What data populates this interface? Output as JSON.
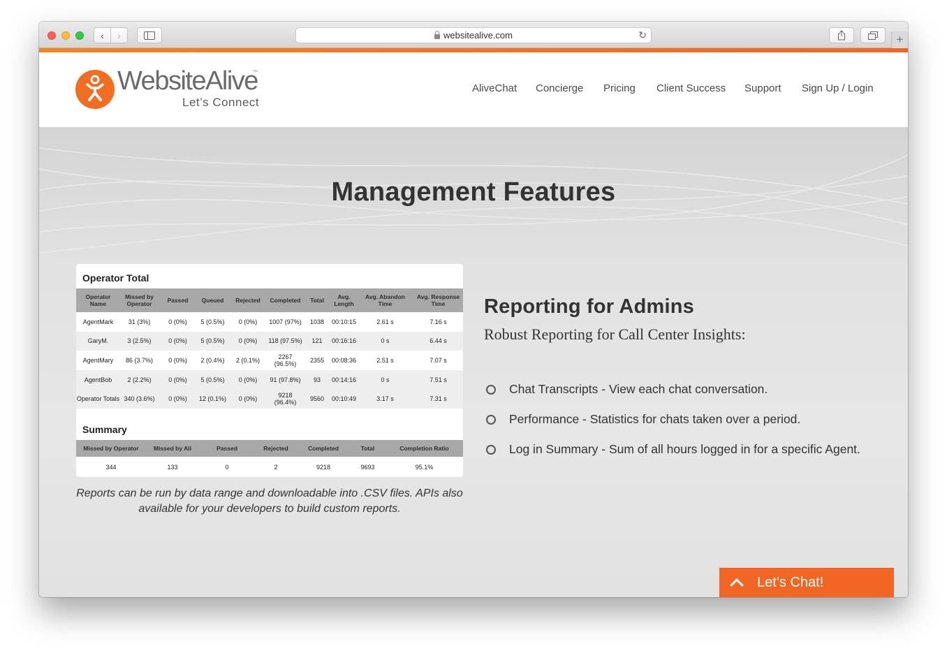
{
  "browser": {
    "url": "websitealive.com"
  },
  "site": {
    "logo_name": "WebsiteAlive",
    "logo_tm": "™",
    "logo_tagline": "Let’s Connect",
    "brand_color": "#f26522",
    "nav": [
      "AliveChat",
      "Concierge",
      "Pricing",
      "Client Success",
      "Support",
      "Sign Up / Login"
    ]
  },
  "hero": {
    "title": "Management Features"
  },
  "report": {
    "title": "Operator Total",
    "columns": [
      "Operator Name",
      "Missed by Operator",
      "Passed",
      "Queued",
      "Rejected",
      "Completed",
      "Total",
      "Avg. Length",
      "Avg. Abandon Time",
      "Avg. Response Time"
    ],
    "rows": [
      [
        "AgentMark",
        "31 (3%)",
        "0 (0%)",
        "5 (0.5%)",
        "0 (0%)",
        "1007 (97%)",
        "1038",
        "00:10:15",
        "2.61 s",
        "7.16 s"
      ],
      [
        "GaryM.",
        "3 (2.5%)",
        "0 (0%)",
        "5 (0.5%)",
        "0 (0%)",
        "118 (97.5%)",
        "121",
        "00:16:16",
        "0 s",
        "6.44 s"
      ],
      [
        "AgentMary",
        "86 (3.7%)",
        "0 (0%)",
        "2 (0.4%)",
        "2 (0.1%)",
        "2267 (96.5%)",
        "2355",
        "00:08:36",
        "2.51 s",
        "7.07 s"
      ],
      [
        "AgentBob",
        "2 (2.2%)",
        "0 (0%)",
        "5 (0.5%)",
        "0 (0%)",
        "91 (97.8%)",
        "93",
        "00:14:16",
        "0 s",
        "7.51 s"
      ],
      [
        "Operator Totals",
        "340 (3.6%)",
        "0 (0%)",
        "12 (0.1%)",
        "0 (0%)",
        "9218 (96.4%)",
        "9560",
        "00:10:49",
        "3.17 s",
        "7.31 s"
      ]
    ],
    "summary_title": "Summary",
    "summary_columns": [
      "Missed by Operator",
      "Missed by All",
      "Passed",
      "Rejected",
      "Completed",
      "Total",
      "Completion Ratio"
    ],
    "summary_values": [
      "344",
      "133",
      "0",
      "2",
      "9218",
      "9693",
      "95.1%"
    ],
    "caption": "Reports can be run by data range and downloadable into .CSV files. APIs also available for your developers to build custom reports."
  },
  "features": {
    "title": "Reporting for Admins",
    "subtitle": "Robust Reporting for Call Center Insights:",
    "bullets": [
      "Chat Transcripts - View each chat conversation.",
      "Performance - Statistics for chats taken over a period.",
      "Log in Summary - Sum of all hours logged in for a specific Agent."
    ]
  },
  "chat_widget": {
    "label": "Let’s Chat!"
  },
  "icons": {
    "back": "chevron-left-icon",
    "forward": "chevron-right-icon",
    "sidebar": "sidebar-icon",
    "share": "share-icon",
    "tabs": "tabs-icon",
    "new_tab": "plus-icon",
    "lock": "lock-icon",
    "reload": "reload-icon",
    "chat": "chevron-up-icon"
  }
}
